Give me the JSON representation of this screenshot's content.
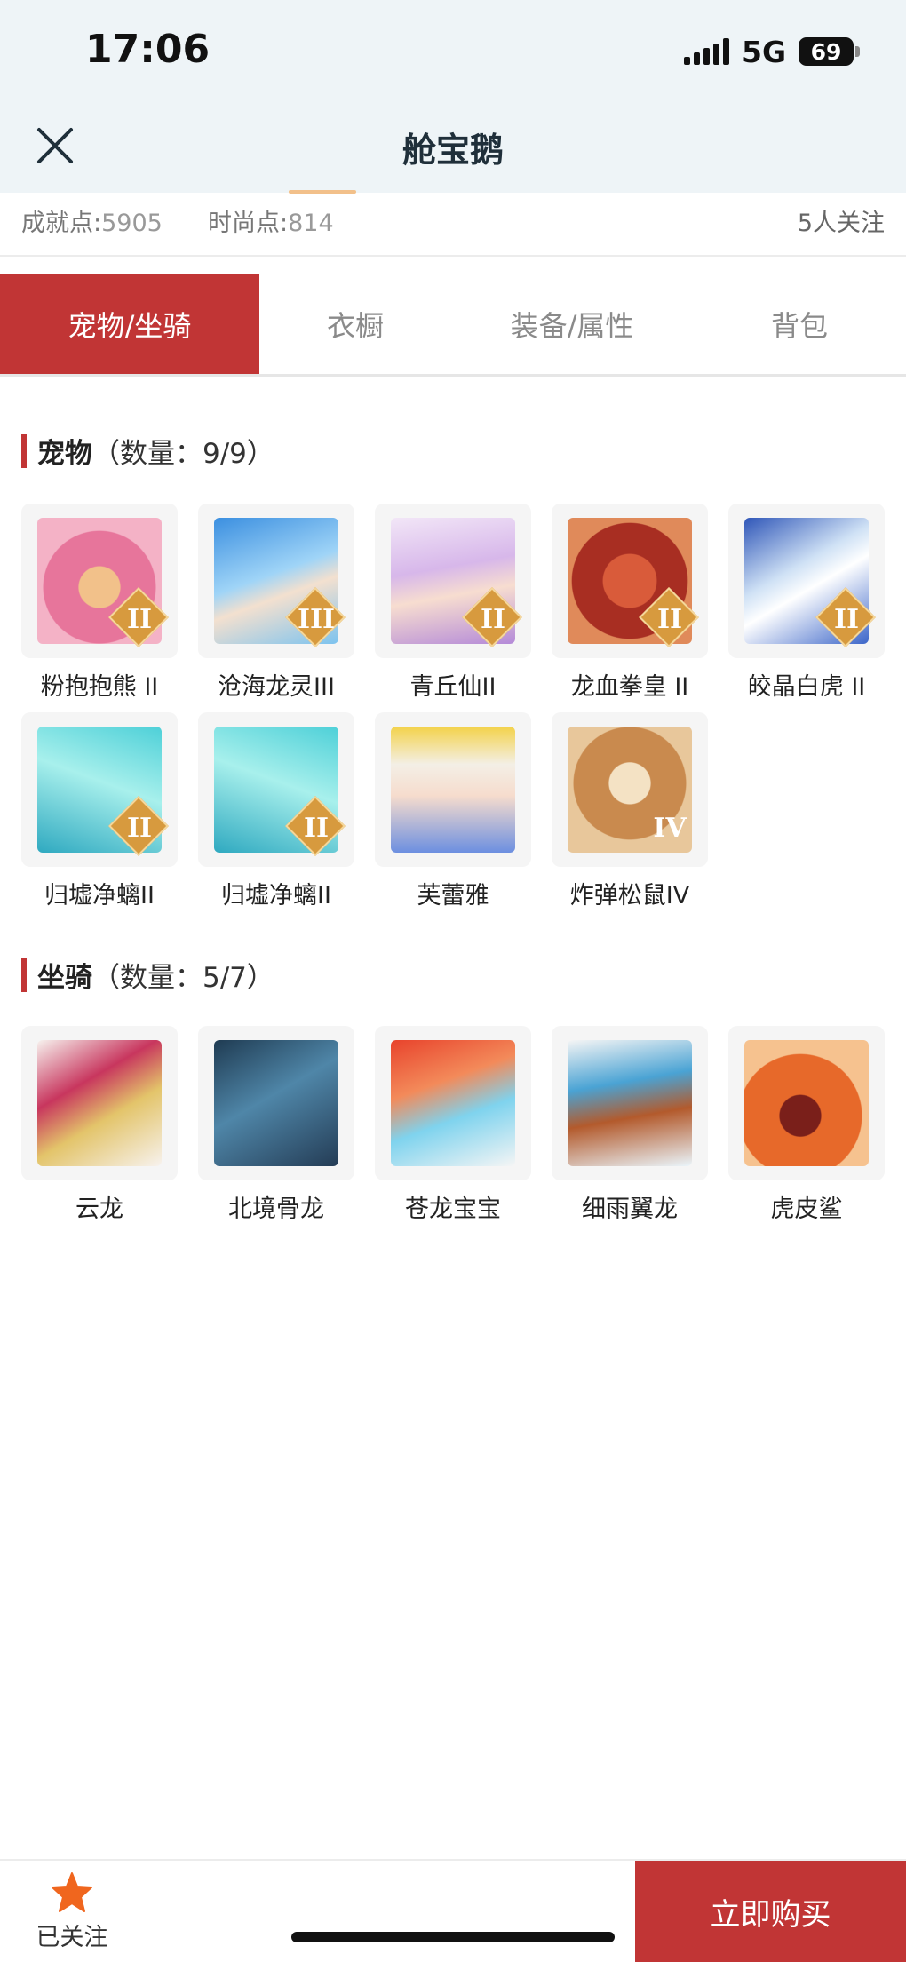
{
  "status_bar": {
    "time": "17:06",
    "network": "5G",
    "battery": "69"
  },
  "header": {
    "title": "舱宝鹅",
    "close_icon": "close-icon"
  },
  "stats": {
    "achievement_label": "成就点:",
    "achievement_value": "5905",
    "fashion_label": "时尚点:",
    "fashion_value": "814",
    "followers": "5人关注"
  },
  "tabs": [
    "宠物/坐骑",
    "衣橱",
    "装备/属性",
    "背包"
  ],
  "active_tab": 0,
  "pets": {
    "name": "宠物",
    "count": "（数量：9/9）",
    "items": [
      {
        "name": "粉抱抱熊 II",
        "badge": "II",
        "icon": "pink-bear-icon"
      },
      {
        "name": "沧海龙灵III",
        "badge": "III",
        "icon": "blue-dragon-spirit-icon"
      },
      {
        "name": "青丘仙II",
        "badge": "II",
        "icon": "fox-fairy-icon"
      },
      {
        "name": "龙血拳皇 II",
        "badge": "II",
        "icon": "red-dragon-boxer-icon"
      },
      {
        "name": "皎晶白虎 II",
        "badge": "II",
        "icon": "white-tiger-icon"
      },
      {
        "name": "归墟净螭II",
        "badge": "II",
        "icon": "teal-dragon-icon"
      },
      {
        "name": "归墟净螭II",
        "badge": "II",
        "icon": "teal-dragon-icon"
      },
      {
        "name": "芙蕾雅",
        "badge": "",
        "icon": "freya-icon"
      },
      {
        "name": "炸弹松鼠IV",
        "badge": "IV",
        "icon": "bomb-squirrel-icon"
      }
    ]
  },
  "mounts": {
    "name": "坐骑",
    "count": "（数量：5/7）",
    "items": [
      {
        "name": "云龙",
        "icon": "cloud-dragon-icon"
      },
      {
        "name": "北境骨龙",
        "icon": "bone-dragon-icon"
      },
      {
        "name": "苍龙宝宝",
        "icon": "baby-dragon-icon"
      },
      {
        "name": "细雨翼龙",
        "icon": "pterosaur-icon"
      },
      {
        "name": "虎皮鲨",
        "icon": "tiger-shark-icon"
      }
    ]
  },
  "bottom": {
    "follow_label": "已关注",
    "buy_label": "立即购买"
  },
  "colors": {
    "accent": "#c13535",
    "badge": "#d79a3e",
    "follow_star": "#f0661e"
  }
}
